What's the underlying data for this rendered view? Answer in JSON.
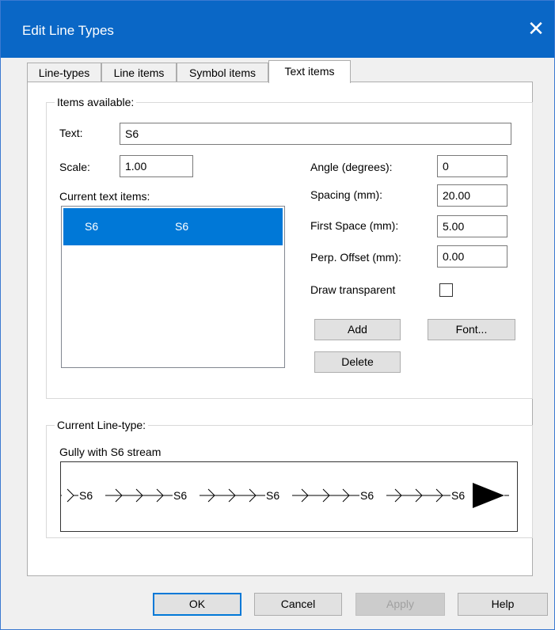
{
  "window": {
    "title": "Edit Line Types",
    "close_glyph": "✕"
  },
  "tabs": [
    {
      "label": "Line-types"
    },
    {
      "label": "Line items"
    },
    {
      "label": "Symbol items"
    },
    {
      "label": "Text items"
    }
  ],
  "items_available": {
    "legend": "Items available:",
    "text_label": "Text:",
    "text_value": "S6",
    "scale_label": "Scale:",
    "scale_value": "1.00",
    "current_items_label": "Current text items:",
    "list": [
      {
        "col1": "S6",
        "col2": "S6"
      }
    ],
    "angle_label": "Angle (degrees):",
    "angle_value": "0",
    "spacing_label": "Spacing (mm):",
    "spacing_value": "20.00",
    "first_space_label": "First Space (mm):",
    "first_space_value": "5.00",
    "perp_offset_label": "Perp. Offset (mm):",
    "perp_offset_value": "0.00",
    "transparent_label": "Draw transparent",
    "transparent_checked": false,
    "add_label": "Add",
    "font_label": "Font...",
    "delete_label": "Delete"
  },
  "current_line_type": {
    "legend": "Current Line-type:",
    "name": "Gully with S6 stream",
    "preview_labels": [
      "S6",
      "S6",
      "S6",
      "S6",
      "S6"
    ]
  },
  "footer": {
    "ok_label": "OK",
    "cancel_label": "Cancel",
    "apply_label": "Apply",
    "help_label": "Help"
  }
}
